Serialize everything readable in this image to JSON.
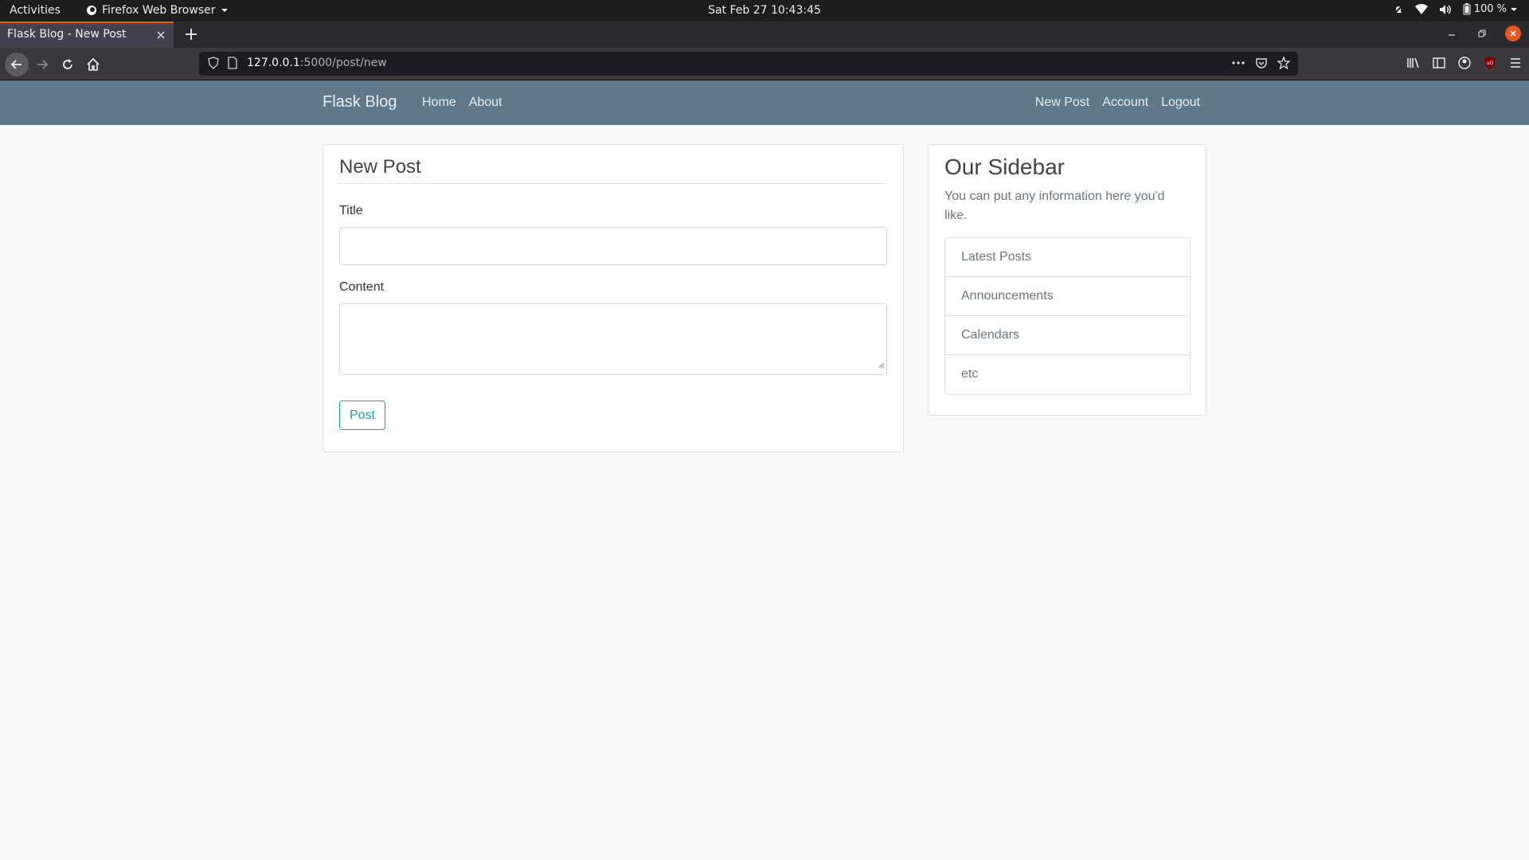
{
  "system_bar": {
    "activities": "Activities",
    "app_name": "Firefox Web Browser",
    "clock": "Sat Feb 27  10:43:45",
    "battery": "100 %"
  },
  "browser": {
    "tab_title": "Flask Blog - New Post",
    "url_host": "127.0.0.1",
    "url_rest": ":5000/post/new",
    "accent_color": "#e66000"
  },
  "site": {
    "brand": "Flask Blog",
    "nav_left": [
      "Home",
      "About"
    ],
    "nav_right": [
      "New Post",
      "Account",
      "Logout"
    ],
    "navbar_color": "#5f788a"
  },
  "form": {
    "legend": "New Post",
    "title_label": "Title",
    "title_value": "",
    "content_label": "Content",
    "content_value": "",
    "submit_label": "Post",
    "submit_color": "#17a2b8"
  },
  "sidebar": {
    "title": "Our Sidebar",
    "text": "You can put any information here you'd like.",
    "items": [
      "Latest Posts",
      "Announcements",
      "Calendars",
      "etc"
    ]
  },
  "icons": {
    "system": [
      "firefox-icon",
      "chevron-down-icon",
      "notification-icon",
      "wifi-icon",
      "volume-icon",
      "battery-icon"
    ],
    "toolbar": [
      "back-icon",
      "forward-icon",
      "reload-icon",
      "home-icon",
      "shield-icon",
      "page-icon",
      "more-icon",
      "pocket-icon",
      "star-icon",
      "library-icon",
      "sidebar-icon",
      "account-icon",
      "ublock-icon",
      "menu-icon"
    ]
  }
}
